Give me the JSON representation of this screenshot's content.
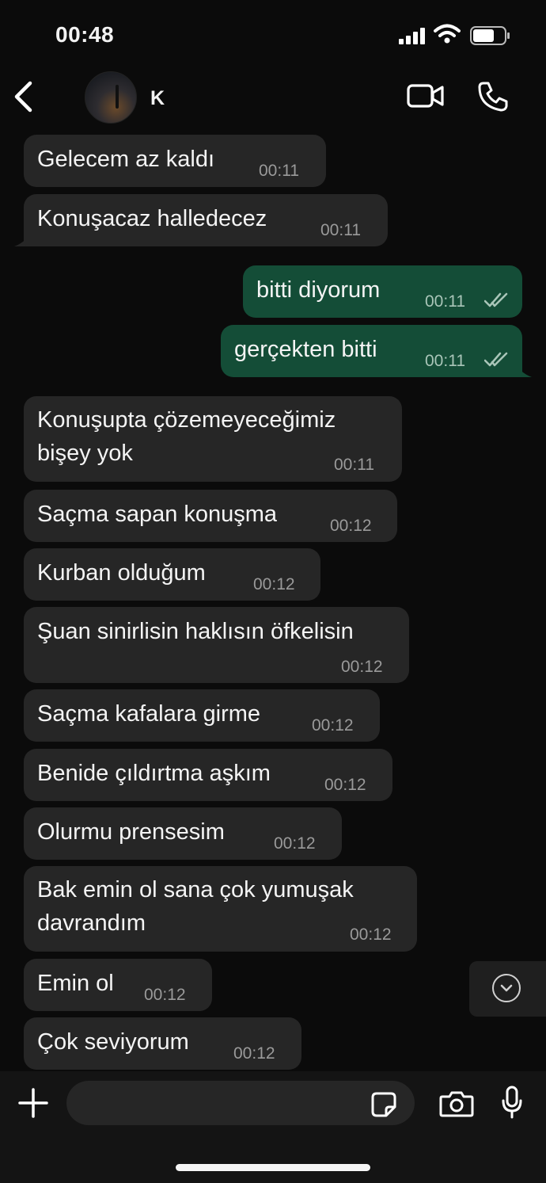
{
  "status_bar": {
    "time": "00:48"
  },
  "header": {
    "contact_name": "K"
  },
  "messages": [
    {
      "dir": "in",
      "text": "Gelecem az kaldı",
      "time": "00:11"
    },
    {
      "dir": "in",
      "text": "Konuşacaz halledecez",
      "time": "00:11"
    },
    {
      "dir": "out",
      "text": "bitti diyorum",
      "time": "00:11",
      "read": true
    },
    {
      "dir": "out",
      "text": "gerçekten bitti",
      "time": "00:11",
      "read": true
    },
    {
      "dir": "in",
      "line1": "Konuşupta çözemeyeceğimiz",
      "line2": "bişey yok",
      "time": "00:11"
    },
    {
      "dir": "in",
      "text": "Saçma sapan konuşma",
      "time": "00:12"
    },
    {
      "dir": "in",
      "text": "Kurban olduğum",
      "time": "00:12"
    },
    {
      "dir": "in",
      "text": "Şuan sinirlisin haklısın öfkelisin",
      "time": "00:12"
    },
    {
      "dir": "in",
      "text": "Saçma kafalara girme",
      "time": "00:12"
    },
    {
      "dir": "in",
      "text": "Benide çıldırtma aşkım",
      "time": "00:12"
    },
    {
      "dir": "in",
      "text": "Olurmu prensesim",
      "time": "00:12"
    },
    {
      "dir": "in",
      "line1": "Bak emin ol sana çok yumuşak",
      "line2": "davrandım",
      "time": "00:12"
    },
    {
      "dir": "in",
      "text": "Emin ol",
      "time": "00:12"
    },
    {
      "dir": "in",
      "text": "Çok seviyorum",
      "time": "00:12"
    }
  ],
  "composer": {
    "value": ""
  },
  "icons": {
    "back": "chevron-left-icon",
    "video": "video-camera-icon",
    "call": "phone-icon",
    "scroll": "chevron-down-circle-icon",
    "attach": "plus-icon",
    "sticker": "sticker-icon",
    "camera": "camera-icon",
    "mic": "microphone-icon"
  },
  "colors": {
    "incoming_bubble": "#262626",
    "outgoing_bubble": "#144d37",
    "background": "#0b0b0b"
  }
}
